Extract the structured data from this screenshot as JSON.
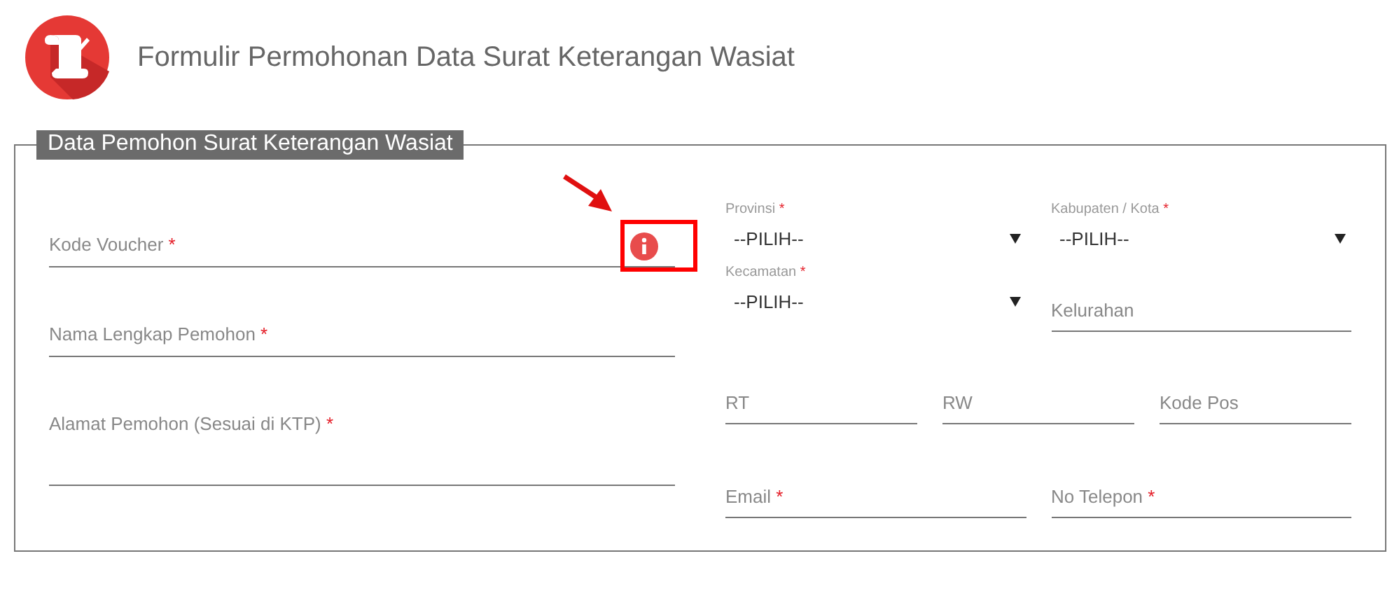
{
  "header": {
    "title": "Formulir Permohonan Data Surat Keterangan Wasiat"
  },
  "section": {
    "legend": "Data Pemohon Surat Keterangan Wasiat"
  },
  "left_fields": [
    {
      "kind": "text",
      "label": "Kode Voucher",
      "required_mark": "*",
      "info_icon": {
        "highlighted": true
      }
    },
    {
      "kind": "text",
      "label": "Nama Lengkap Pemohon",
      "required_mark": "*"
    },
    {
      "kind": "textarea",
      "label": "Alamat Pemohon (Sesuai di KTP)",
      "required_mark": "*"
    }
  ],
  "right_rows": [
    [
      {
        "kind": "select",
        "label": "Provinsi",
        "required_mark": "*",
        "value": "--PILIH--"
      },
      {
        "kind": "select",
        "label": "Kabupaten / Kota",
        "required_mark": "*",
        "value": "--PILIH--"
      }
    ],
    [
      {
        "kind": "select",
        "label": "Kecamatan",
        "required_mark": "*",
        "value": "--PILIH--"
      },
      {
        "kind": "text",
        "label": "Kelurahan"
      }
    ],
    [
      {
        "kind": "text",
        "label": "RT"
      },
      {
        "kind": "text",
        "label": "RW"
      },
      {
        "kind": "text",
        "label": "Kode Pos"
      }
    ],
    [
      {
        "kind": "text",
        "label": "Email",
        "required_mark": "*"
      },
      {
        "kind": "text",
        "label": "No Telepon",
        "required_mark": "*"
      }
    ]
  ]
}
